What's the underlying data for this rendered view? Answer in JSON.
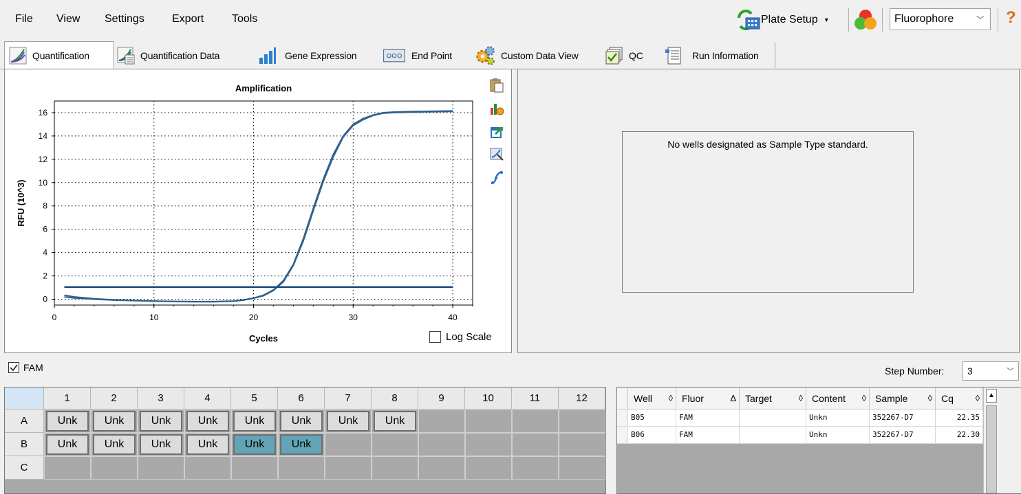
{
  "menu": [
    "File",
    "View",
    "Settings",
    "Export",
    "Tools"
  ],
  "toolbar": {
    "plate_setup_label": "Plate Setup",
    "fluorophore_select": "Fluorophore",
    "help_glyph": "?"
  },
  "tabs": [
    {
      "label": "Quantification",
      "icon": "amplification-icon",
      "active": true
    },
    {
      "label": "Quantification Data",
      "icon": "quant-data-icon"
    },
    {
      "label": "Gene Expression",
      "icon": "bar-chart-icon"
    },
    {
      "label": "End Point",
      "icon": "end-point-icon"
    },
    {
      "label": "Custom Data View",
      "icon": "gears-icon"
    },
    {
      "label": "QC",
      "icon": "qc-icon"
    },
    {
      "label": "Run Information",
      "icon": "run-info-icon"
    }
  ],
  "chart_tools": [
    "copy-icon",
    "chart-settings-icon",
    "export-icon",
    "zoom-icon",
    "curve-icon"
  ],
  "chart_data": {
    "type": "line",
    "title": "Amplification",
    "xlabel": "Cycles",
    "ylabel": "RFU (10^3)",
    "xlim": [
      0,
      42
    ],
    "ylim": [
      -0.5,
      17
    ],
    "x_ticks": [
      0,
      10,
      20,
      30,
      40
    ],
    "y_ticks": [
      0,
      2,
      4,
      6,
      8,
      10,
      12,
      14,
      16
    ],
    "grid": true,
    "series": [
      {
        "x": [
          1,
          2,
          4,
          6,
          8,
          10,
          12,
          14,
          16,
          18,
          19,
          20,
          21,
          22,
          23,
          24,
          25,
          26,
          27,
          28,
          29,
          30,
          31,
          32,
          33,
          34,
          36,
          38,
          40
        ],
        "values": [
          0.35,
          0.2,
          0.05,
          -0.05,
          -0.1,
          -0.15,
          -0.18,
          -0.2,
          -0.2,
          -0.15,
          -0.05,
          0.1,
          0.35,
          0.8,
          1.6,
          3.0,
          5.2,
          7.8,
          10.3,
          12.4,
          14.0,
          15.0,
          15.5,
          15.8,
          16.0,
          16.05,
          16.1,
          16.12,
          16.15
        ]
      },
      {
        "x": [
          1,
          2,
          4,
          6,
          8,
          10,
          12,
          14,
          16,
          18,
          19,
          20,
          21,
          22,
          23,
          24,
          25,
          26,
          27,
          28,
          29,
          30,
          31,
          32,
          33,
          34,
          36,
          38,
          40
        ],
        "values": [
          0.2,
          0.1,
          0.0,
          -0.08,
          -0.12,
          -0.17,
          -0.2,
          -0.22,
          -0.22,
          -0.17,
          -0.08,
          0.08,
          0.3,
          0.75,
          1.5,
          2.9,
          5.0,
          7.6,
          10.1,
          12.2,
          13.9,
          14.9,
          15.4,
          15.75,
          15.95,
          16.0,
          16.05,
          16.08,
          16.1
        ]
      },
      {
        "x": [
          1,
          40
        ],
        "values": [
          1.05,
          1.05
        ]
      }
    ],
    "colors": {
      "curve": "#2f5f8f",
      "threshold": "#1d4a7a"
    }
  },
  "log_scale_label": "Log Scale",
  "standard_message": "No wells designated as Sample Type standard.",
  "fam_label": "FAM",
  "step_number": {
    "label": "Step Number:",
    "value": "3"
  },
  "plate": {
    "columns": [
      "1",
      "2",
      "3",
      "4",
      "5",
      "6",
      "7",
      "8",
      "9",
      "10",
      "11",
      "12"
    ],
    "rows": [
      {
        "label": "A",
        "wells": [
          "Unk",
          "Unk",
          "Unk",
          "Unk",
          "Unk",
          "Unk",
          "Unk",
          "Unk",
          "",
          "",
          "",
          ""
        ],
        "selected": []
      },
      {
        "label": "B",
        "wells": [
          "Unk",
          "Unk",
          "Unk",
          "Unk",
          "Unk",
          "Unk",
          "",
          "",
          "",
          "",
          "",
          ""
        ],
        "selected": [
          4,
          5
        ]
      },
      {
        "label": "C",
        "wells": [
          "",
          "",
          "",
          "",
          "",
          "",
          "",
          "",
          "",
          "",
          "",
          ""
        ],
        "selected": []
      }
    ]
  },
  "table": {
    "headers": [
      "Well",
      "Fluor",
      "Target",
      "Content",
      "Sample",
      "Cq"
    ],
    "sort_marks": [
      "◊",
      "Δ",
      "◊",
      "◊",
      "◊",
      "◊"
    ],
    "rows": [
      [
        "B05",
        "FAM",
        "",
        "Unkn",
        "352267-D7",
        "22.35"
      ],
      [
        "B06",
        "FAM",
        "",
        "Unkn",
        "352267-D7",
        "22.30"
      ]
    ]
  }
}
